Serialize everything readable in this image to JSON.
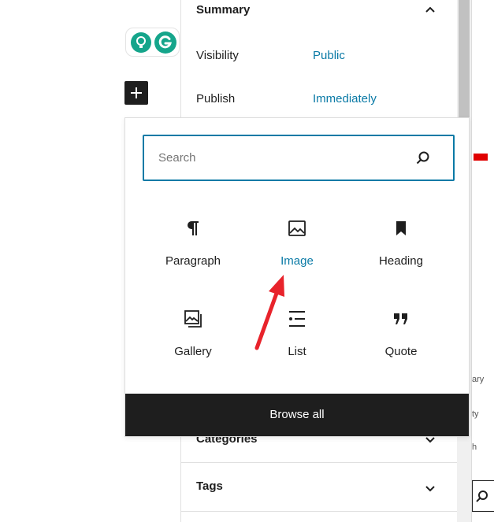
{
  "sidebar": {
    "summary": {
      "title": "Summary",
      "rows": [
        {
          "label": "Visibility",
          "value": "Public"
        },
        {
          "label": "Publish",
          "value": "Immediately"
        }
      ]
    },
    "panels": [
      {
        "title": "Categories"
      },
      {
        "title": "Tags"
      }
    ]
  },
  "inserter": {
    "search": {
      "placeholder": "Search",
      "value": ""
    },
    "blocks": [
      {
        "label": "Paragraph",
        "icon": "paragraph-icon"
      },
      {
        "label": "Image",
        "icon": "image-icon",
        "active": true
      },
      {
        "label": "Heading",
        "icon": "bookmark-icon"
      },
      {
        "label": "Gallery",
        "icon": "gallery-icon"
      },
      {
        "label": "List",
        "icon": "list-icon"
      },
      {
        "label": "Quote",
        "icon": "quote-icon"
      }
    ],
    "browse_all_label": "Browse all"
  },
  "clipped_right": {
    "fragments": [
      "ary",
      "ty",
      "h"
    ]
  },
  "colors": {
    "accent": "#0a7aa6",
    "dark": "#1e1e1e",
    "annotation": "#e8232b",
    "grammarly_green": "#15a58b"
  }
}
